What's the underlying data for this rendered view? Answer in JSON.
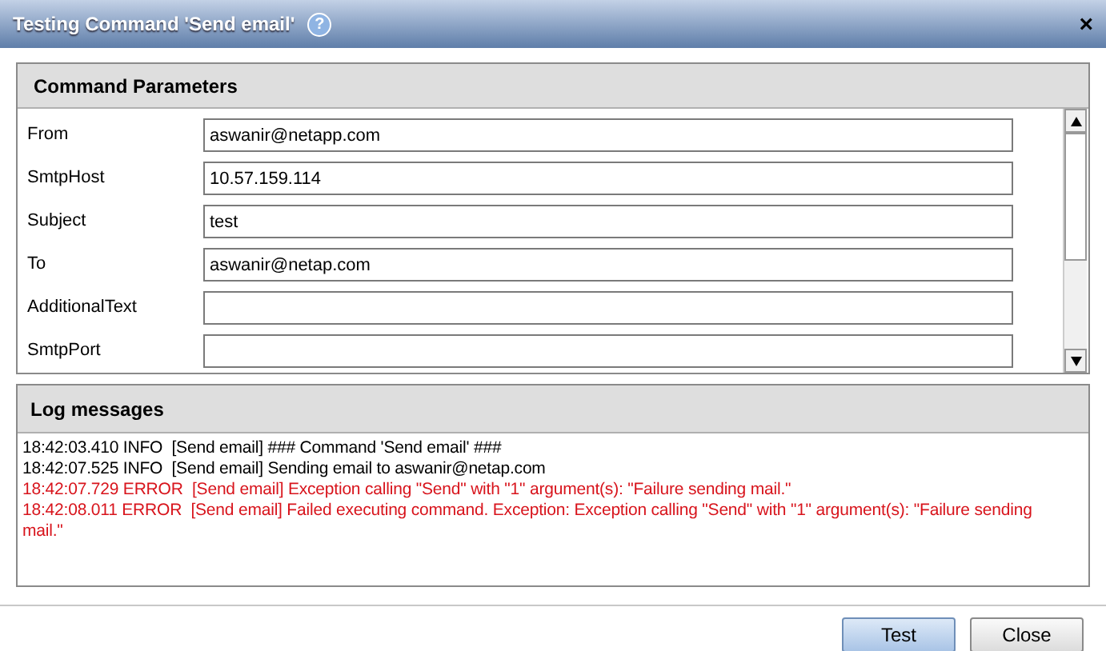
{
  "window": {
    "title": "Testing Command 'Send email'",
    "help": "?",
    "close": "×"
  },
  "parameters": {
    "title": "Command Parameters",
    "fields": [
      {
        "label": "From",
        "value": "aswanir@netapp.com"
      },
      {
        "label": "SmtpHost",
        "value": "10.57.159.114"
      },
      {
        "label": "Subject",
        "value": "test"
      },
      {
        "label": "To",
        "value": "aswanir@netap.com"
      },
      {
        "label": "AdditionalText"
      },
      {
        "label": "SmtpPort"
      }
    ]
  },
  "log": {
    "title": "Log messages",
    "lines": [
      {
        "kind": "info",
        "text": "18:42:03.410 INFO  [Send email] ### Command 'Send email' ###"
      },
      {
        "kind": "info",
        "text": "18:42:07.525 INFO  [Send email] Sending email to aswanir@netap.com"
      },
      {
        "kind": "error",
        "text": "18:42:07.729 ERROR  [Send email] Exception calling \"Send\" with \"1\" argument(s): \"Failure sending mail.\""
      },
      {
        "kind": "error",
        "text": "18:42:08.011 ERROR  [Send email] Failed executing command. Exception: Exception calling \"Send\" with \"1\" argument(s): \"Failure sending mail.\""
      }
    ]
  },
  "buttons": [
    {
      "label": "Test",
      "kind": "primary"
    },
    {
      "label": "Close",
      "kind": "default"
    }
  ]
}
